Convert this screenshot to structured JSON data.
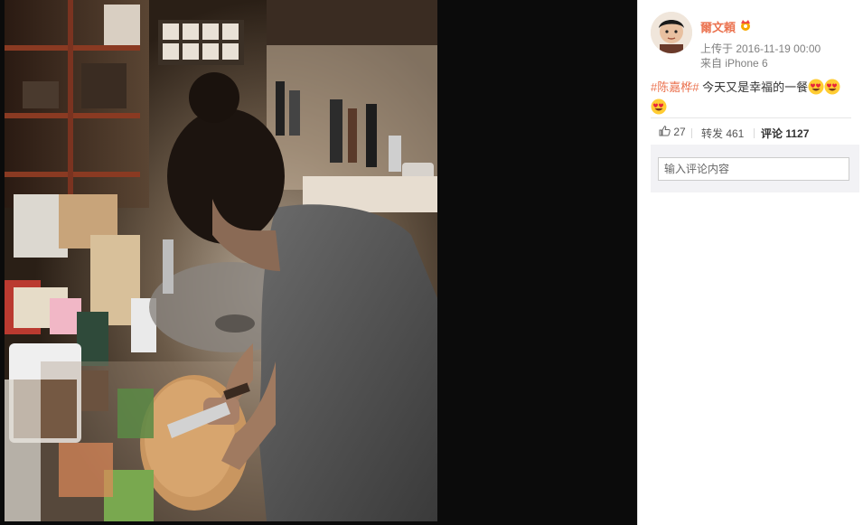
{
  "photo": {
    "description_icon": "photo-image"
  },
  "post": {
    "username": "爾文頼",
    "badge_icon": "vip-crown-icon",
    "upload_time": "上传于 2016-11-19 00:00",
    "source": "来自 iPhone 6",
    "topic": "#陈嘉桦#",
    "text": " 今天又是幸福的一餐",
    "emoji_icon": "heart-eyes-emoji-icon",
    "emoji_count": 3
  },
  "actions": {
    "like_count": "27",
    "repost_label": "转发 461",
    "comment_label": "评论",
    "comment_count": "1127"
  },
  "comment": {
    "placeholder": "输入评论内容"
  },
  "colors": {
    "accent": "#eb7350",
    "panel_bg": "#ffffff",
    "viewer_bg": "#0b0b0b"
  }
}
